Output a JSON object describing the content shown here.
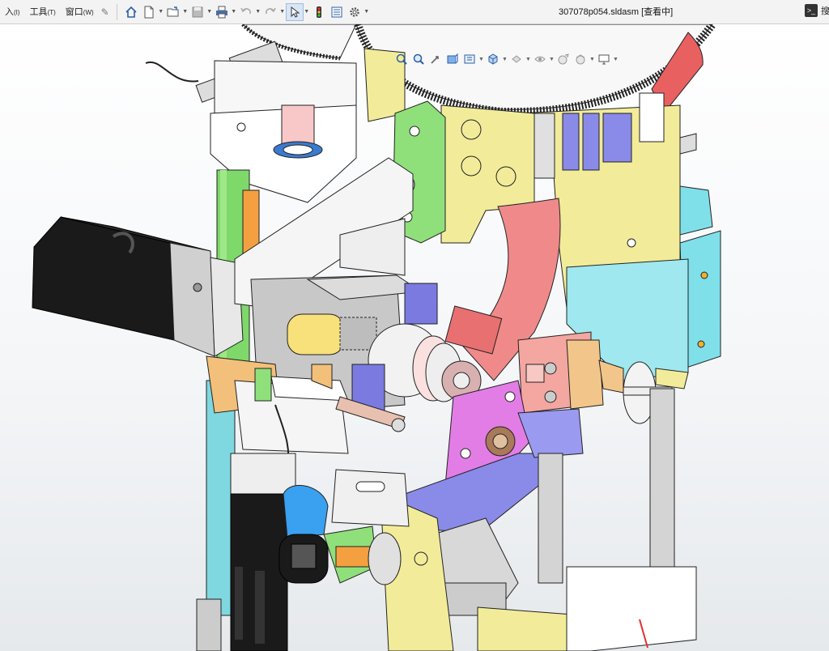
{
  "menu": {
    "items": [
      {
        "label": "入",
        "hotkey": "(I)"
      },
      {
        "label": "工具",
        "hotkey": "(T)"
      },
      {
        "label": "窗口",
        "hotkey": "(W)"
      }
    ]
  },
  "window": {
    "title": "307078p054.sldasm [查看中]"
  },
  "search": {
    "label": "搜"
  },
  "toolbar_icons": [
    "home-icon",
    "new-document-icon",
    "open-folder-icon",
    "save-icon",
    "print-icon",
    "undo-icon",
    "redo-icon",
    "select-arrow-icon",
    "traffic-light-icon",
    "file-properties-icon",
    "options-gear-icon"
  ],
  "hud_icons": [
    "zoom-to-fit-icon",
    "zoom-to-area-icon",
    "previous-view-icon",
    "section-view-icon",
    "dynamic-annotation-icon",
    "view-orientation-icon",
    "display-style-icon",
    "hide-show-icon",
    "edit-appearance-icon",
    "apply-scene-icon",
    "view-settings-icon"
  ],
  "colors": {
    "accent_blue": "#1f5fbf",
    "part_yellow": "#f2ec9a",
    "part_green": "#8fe07a",
    "part_pink": "#f08a8a",
    "part_magenta": "#e37de6",
    "part_cyan": "#7fe0ea",
    "part_purple": "#8a8ae8",
    "part_grey": "#dcdcdc",
    "motor_black": "#1a1a1a"
  }
}
